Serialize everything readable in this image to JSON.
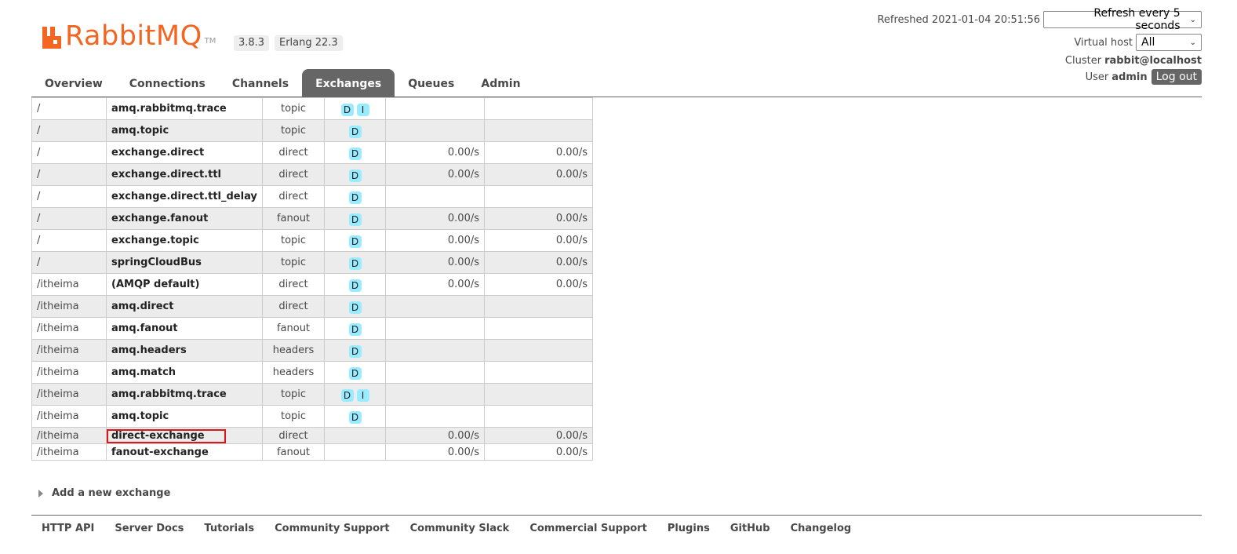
{
  "header": {
    "logo_text": "RabbitMQ",
    "logo_tm": "TM",
    "version": "3.8.3",
    "erlang": "Erlang 22.3",
    "refreshed_label": "Refreshed 2021-01-04 20:51:56",
    "refresh_select": "Refresh every 5 seconds",
    "vhost_label": "Virtual host",
    "vhost_select": "All",
    "cluster_label": "Cluster",
    "cluster_value": "rabbit@localhost",
    "user_label": "User",
    "user_value": "admin",
    "logout_label": "Log out"
  },
  "tabs": [
    "Overview",
    "Connections",
    "Channels",
    "Exchanges",
    "Queues",
    "Admin"
  ],
  "active_tab": "Exchanges",
  "exchanges": [
    {
      "vhost": "/",
      "name": "amq.rabbitmq.trace",
      "type": "topic",
      "features": [
        "D",
        "I"
      ],
      "rate_in": "",
      "rate_out": ""
    },
    {
      "vhost": "/",
      "name": "amq.topic",
      "type": "topic",
      "features": [
        "D"
      ],
      "rate_in": "",
      "rate_out": ""
    },
    {
      "vhost": "/",
      "name": "exchange.direct",
      "type": "direct",
      "features": [
        "D"
      ],
      "rate_in": "0.00/s",
      "rate_out": "0.00/s"
    },
    {
      "vhost": "/",
      "name": "exchange.direct.ttl",
      "type": "direct",
      "features": [
        "D"
      ],
      "rate_in": "0.00/s",
      "rate_out": "0.00/s"
    },
    {
      "vhost": "/",
      "name": "exchange.direct.ttl_delay",
      "type": "direct",
      "features": [
        "D"
      ],
      "rate_in": "",
      "rate_out": ""
    },
    {
      "vhost": "/",
      "name": "exchange.fanout",
      "type": "fanout",
      "features": [
        "D"
      ],
      "rate_in": "0.00/s",
      "rate_out": "0.00/s"
    },
    {
      "vhost": "/",
      "name": "exchange.topic",
      "type": "topic",
      "features": [
        "D"
      ],
      "rate_in": "0.00/s",
      "rate_out": "0.00/s"
    },
    {
      "vhost": "/",
      "name": "springCloudBus",
      "type": "topic",
      "features": [
        "D"
      ],
      "rate_in": "0.00/s",
      "rate_out": "0.00/s"
    },
    {
      "vhost": "/itheima",
      "name": "(AMQP default)",
      "type": "direct",
      "features": [
        "D"
      ],
      "rate_in": "0.00/s",
      "rate_out": "0.00/s"
    },
    {
      "vhost": "/itheima",
      "name": "amq.direct",
      "type": "direct",
      "features": [
        "D"
      ],
      "rate_in": "",
      "rate_out": ""
    },
    {
      "vhost": "/itheima",
      "name": "amq.fanout",
      "type": "fanout",
      "features": [
        "D"
      ],
      "rate_in": "",
      "rate_out": ""
    },
    {
      "vhost": "/itheima",
      "name": "amq.headers",
      "type": "headers",
      "features": [
        "D"
      ],
      "rate_in": "",
      "rate_out": ""
    },
    {
      "vhost": "/itheima",
      "name": "amq.match",
      "type": "headers",
      "features": [
        "D"
      ],
      "rate_in": "",
      "rate_out": ""
    },
    {
      "vhost": "/itheima",
      "name": "amq.rabbitmq.trace",
      "type": "topic",
      "features": [
        "D",
        "I"
      ],
      "rate_in": "",
      "rate_out": ""
    },
    {
      "vhost": "/itheima",
      "name": "amq.topic",
      "type": "topic",
      "features": [
        "D"
      ],
      "rate_in": "",
      "rate_out": ""
    },
    {
      "vhost": "/itheima",
      "name": "direct-exchange",
      "type": "direct",
      "features": [],
      "rate_in": "0.00/s",
      "rate_out": "0.00/s",
      "highlighted": true
    },
    {
      "vhost": "/itheima",
      "name": "fanout-exchange",
      "type": "fanout",
      "features": [],
      "rate_in": "0.00/s",
      "rate_out": "0.00/s"
    }
  ],
  "add_exchange_label": "Add a new exchange",
  "footer_links": [
    "HTTP API",
    "Server Docs",
    "Tutorials",
    "Community Support",
    "Community Slack",
    "Commercial Support",
    "Plugins",
    "GitHub",
    "Changelog"
  ],
  "colors": {
    "brand_orange": "#f26622",
    "active_tab_bg": "#666666",
    "feature_badge_bg": "#99ebff",
    "highlight_box": "#e01616"
  }
}
